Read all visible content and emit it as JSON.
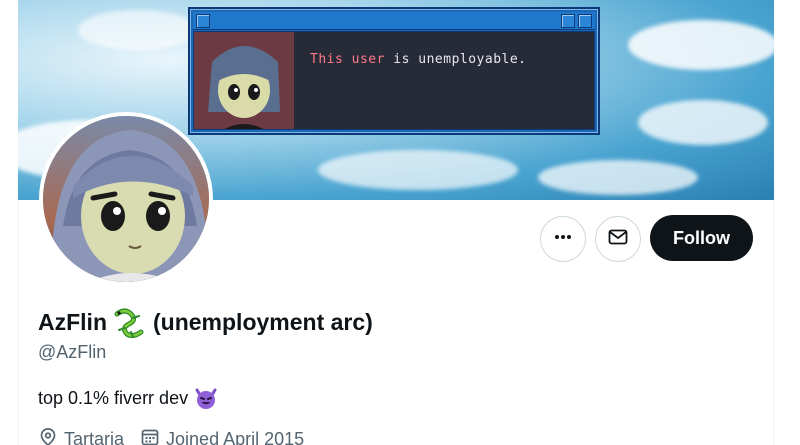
{
  "banner": {
    "window_message_name": "This user",
    "window_message_rest": " is unemployable."
  },
  "actions": {
    "more_icon": "more-dots-icon",
    "message_icon": "mail-icon",
    "follow_label": "Follow"
  },
  "profile": {
    "display_name_first": "AzFlin",
    "name_emoji": "lizard",
    "display_name_rest": "(unemployment arc)",
    "handle": "@AzFlin",
    "bio_text": "top 0.1% fiverr dev",
    "bio_emoji": "smiling-devil",
    "location": "Tartaria",
    "joined": "Joined April 2015"
  },
  "colors": {
    "follow_bg": "#0f1419",
    "secondary_text": "#536471",
    "retro_window_blue": "#1c68b6",
    "retro_highlight": "#ff7a86"
  }
}
